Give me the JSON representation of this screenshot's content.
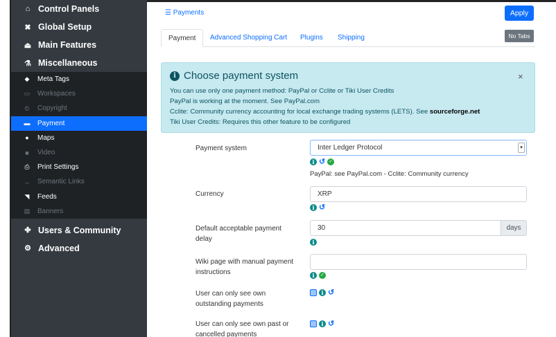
{
  "sidebar": {
    "sections_top": [
      {
        "label": "Control Panels",
        "icon": "home-icon",
        "glyph": "⌂"
      },
      {
        "label": "Global Setup",
        "icon": "wrench-icon",
        "glyph": "✖"
      },
      {
        "label": "Main Features",
        "icon": "eject-icon",
        "glyph": "⏏"
      },
      {
        "label": "Miscellaneous",
        "icon": "flask-icon",
        "glyph": "⚗"
      }
    ],
    "items": [
      {
        "label": "Meta Tags",
        "icon": "tag-icon",
        "glyph": "◆",
        "muted": false,
        "active": false
      },
      {
        "label": "Workspaces",
        "icon": "desktop-icon",
        "glyph": "▭",
        "muted": true,
        "active": false
      },
      {
        "label": "Copyright",
        "icon": "copyright-icon",
        "glyph": "©",
        "muted": true,
        "active": false
      },
      {
        "label": "Payment",
        "icon": "credit-card-icon",
        "glyph": "▬",
        "muted": false,
        "active": true
      },
      {
        "label": "Maps",
        "icon": "map-marker-icon",
        "glyph": "●",
        "muted": false,
        "active": false
      },
      {
        "label": "Video",
        "icon": "video-icon",
        "glyph": "■",
        "muted": true,
        "active": false
      },
      {
        "label": "Print Settings",
        "icon": "print-icon",
        "glyph": "⎙",
        "muted": false,
        "active": false
      },
      {
        "label": "Semantic Links",
        "icon": "arrows-h-icon",
        "glyph": "↔",
        "muted": true,
        "active": false
      },
      {
        "label": "Feeds",
        "icon": "rss-icon",
        "glyph": "◥",
        "muted": false,
        "active": false
      },
      {
        "label": "Banners",
        "icon": "banner-icon",
        "glyph": "▤",
        "muted": true,
        "active": false
      }
    ],
    "sections_bottom": [
      {
        "label": "Users & Community",
        "icon": "users-icon",
        "glyph": "✤"
      },
      {
        "label": "Advanced",
        "icon": "cogs-icon",
        "glyph": "⚙"
      }
    ]
  },
  "breadcrumb": {
    "icon": "list-icon",
    "label": "Payments"
  },
  "toolbar": {
    "apply_label": "Apply",
    "notabs_label": "No Tabs"
  },
  "tabs": [
    {
      "label": "Payment",
      "active": true
    },
    {
      "label": "Advanced Shopping Cart",
      "active": false
    },
    {
      "label": "Plugins",
      "active": false
    },
    {
      "label": "Shipping",
      "active": false
    }
  ],
  "alert": {
    "title": "Choose payment system",
    "close": "×",
    "line1": "You can use only one payment method: PayPal or Cclite or Tiki User Credits",
    "line2": "PayPal is working at the moment. See PayPal.com",
    "line3_prefix": "Cclite: Community currency accounting for local exchange trading systems (LETS). See ",
    "line3_link": "sourceforge.net",
    "line4": "Tiki User Credits: Requires this other feature to be configured"
  },
  "form": {
    "payment_system": {
      "label": "Payment system",
      "value": "Inter Ledger Protocol",
      "help": "PayPal: see PayPal.com - Cclite: Community currency"
    },
    "currency": {
      "label": "Currency",
      "value": "XRP"
    },
    "delay": {
      "label_line1": "Default acceptable payment",
      "label_line2": "delay",
      "value": "30",
      "unit": "days"
    },
    "wiki_page": {
      "label_line1": "Wiki page with manual payment",
      "label_line2": "instructions",
      "value": ""
    },
    "own_outstanding": {
      "label_line1": "User can only see own",
      "label_line2": "outstanding payments"
    },
    "own_past": {
      "label_line1": "User can only see own past or",
      "label_line2": "cancelled payments"
    }
  },
  "colors": {
    "accent": "#0d6efd",
    "sidebar": "#343a40",
    "alert_bg": "#c7e9f0"
  }
}
